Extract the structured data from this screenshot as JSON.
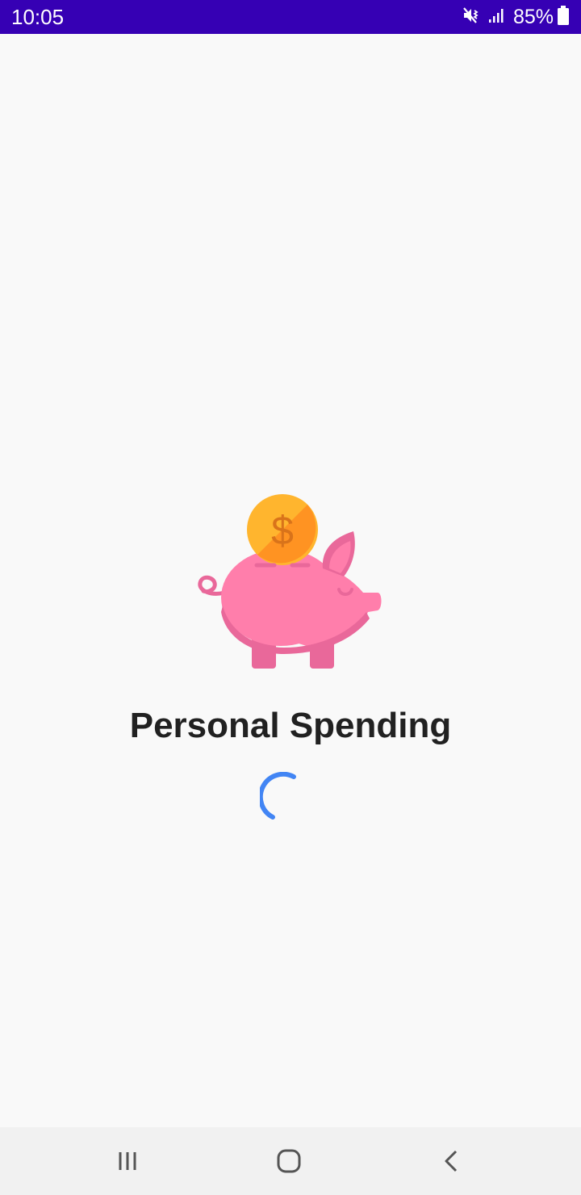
{
  "status_bar": {
    "time": "10:05",
    "battery": "85%",
    "icons": [
      "mute-vibrate-icon",
      "signal-icon",
      "battery-icon"
    ],
    "background": "#3600b4"
  },
  "app": {
    "title": "Personal Spending",
    "logo_icon": "piggy-bank-coin-icon",
    "loading_indicator": "loading-spinner",
    "spinner_color": "#4285f4"
  },
  "nav_bar": {
    "buttons": [
      "recent-apps-icon",
      "home-icon",
      "back-icon"
    ]
  },
  "colors": {
    "background": "#f9f9f9",
    "title_text": "#212121",
    "pig_pink": "#ff7eab",
    "pig_dark": "#e9689a",
    "coin_yellow": "#ffb52e",
    "coin_orange": "#ff9322",
    "coin_symbol": "#d9731a"
  }
}
